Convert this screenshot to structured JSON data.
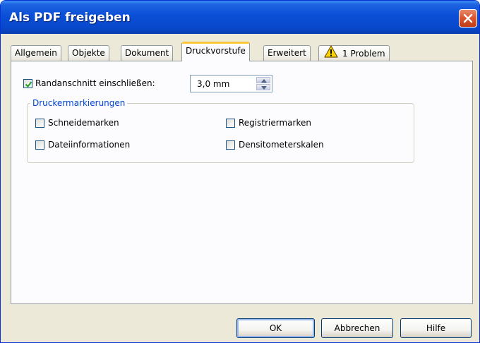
{
  "window": {
    "title": "Als PDF freigeben",
    "close_icon": "close-icon"
  },
  "tabs": [
    {
      "label": "Allgemein",
      "active": false
    },
    {
      "label": "Objekte",
      "active": false
    },
    {
      "label": "Dokument",
      "active": false
    },
    {
      "label": "Druckvorstufe",
      "active": true
    },
    {
      "label": "Erweitert",
      "active": false
    },
    {
      "label": "1 Problem",
      "active": false,
      "icon": "warning-icon"
    }
  ],
  "bleed": {
    "label": "Randanschnitt einschließen:",
    "checked": true,
    "value": "3,0 mm"
  },
  "printer_marks": {
    "legend": "Druckermarkierungen",
    "items": [
      {
        "label": "Schneidemarken",
        "checked": false
      },
      {
        "label": "Registriermarken",
        "checked": false
      },
      {
        "label": "Dateiinformationen",
        "checked": false
      },
      {
        "label": "Densitometerskalen",
        "checked": false
      }
    ]
  },
  "buttons": {
    "ok": "OK",
    "cancel": "Abbrechen",
    "help": "Hilfe"
  },
  "colors": {
    "titlebar": "#0a4fd6",
    "dialog": "#ece9d8",
    "groupbox_legend": "#0046d5",
    "active_tab_accent": "#ffc83c"
  }
}
